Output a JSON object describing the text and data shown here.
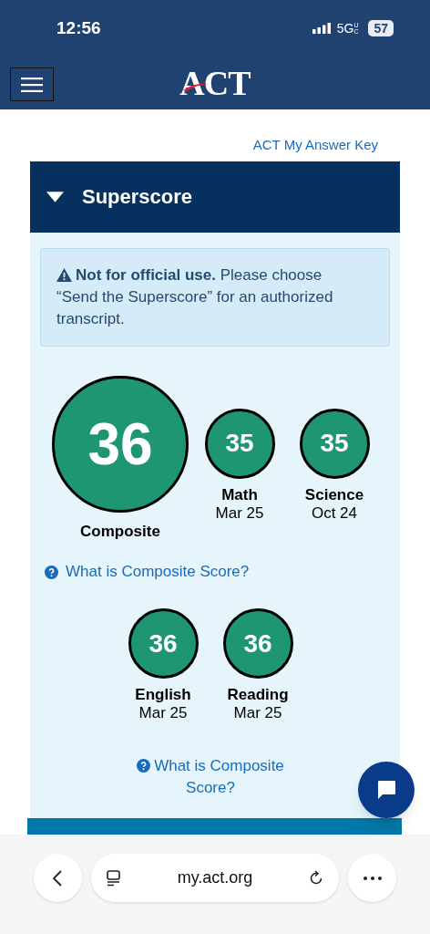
{
  "status_bar": {
    "time": "12:56",
    "network": "5G",
    "network_badge": "UC",
    "battery": "57"
  },
  "header": {
    "logo": "ACT"
  },
  "answer_key_link": "ACT My Answer Key",
  "superscore": {
    "title": "Superscore",
    "expanded": true,
    "notice": "**Not for official use.** Please choose “Send the Superscore” for an authorized transcript.",
    "top_scores": [
      {
        "kind": "composite",
        "value": "36",
        "name": "Composite"
      },
      {
        "kind": "subject",
        "value": "35",
        "name": "Math",
        "date": "Mar 25"
      },
      {
        "kind": "subject",
        "value": "35",
        "name": "Science",
        "date": "Oct 24"
      }
    ],
    "help_link_1": "What is Composite Score?",
    "bottom_scores": [
      {
        "kind": "subject",
        "value": "36",
        "name": "English",
        "date": "Mar 25"
      },
      {
        "kind": "subject",
        "value": "36",
        "name": "Reading",
        "date": "Mar 25"
      }
    ],
    "help_link_2": "What is Composite Score?"
  },
  "browser": {
    "url": "my.act.org"
  }
}
